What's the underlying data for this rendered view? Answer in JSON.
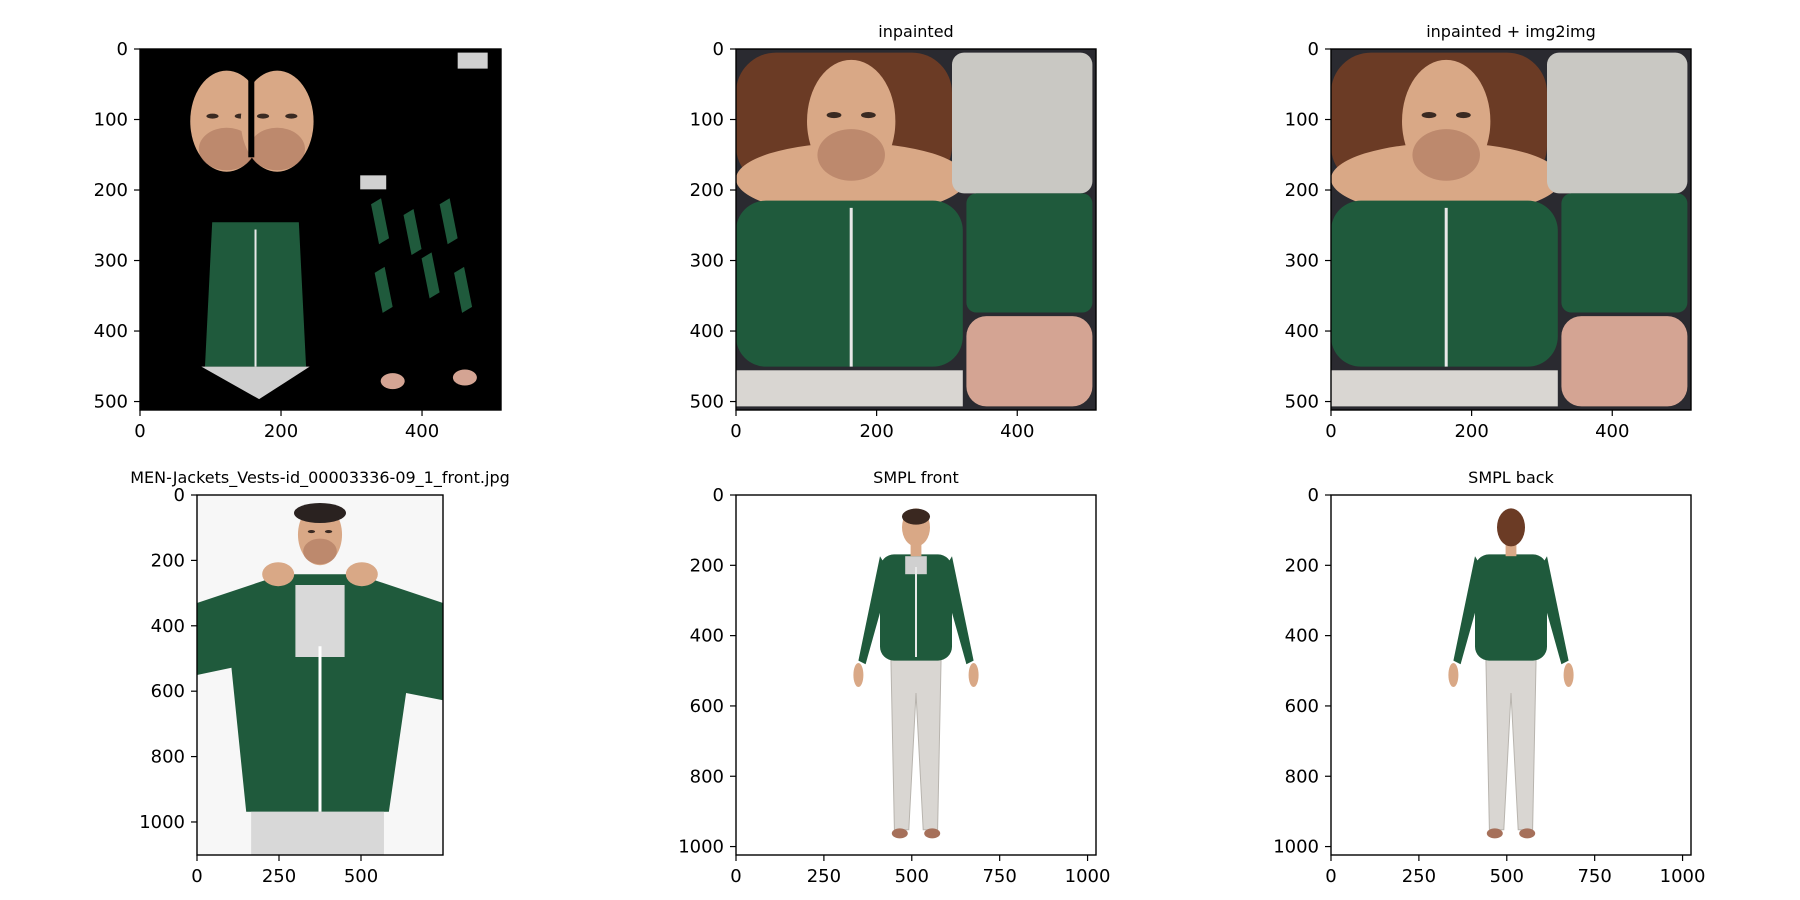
{
  "chart_data": [
    {
      "type": "image",
      "title": "",
      "content": "uv texture (partial)",
      "xlim": [
        0,
        512
      ],
      "ylim": [
        512,
        0
      ],
      "xticks": [
        0,
        200,
        400
      ],
      "yticks": [
        0,
        100,
        200,
        300,
        400,
        500
      ]
    },
    {
      "type": "image",
      "title": "inpainted",
      "content": "uv texture inpainted",
      "xlim": [
        0,
        512
      ],
      "ylim": [
        512,
        0
      ],
      "xticks": [
        0,
        200,
        400
      ],
      "yticks": [
        0,
        100,
        200,
        300,
        400,
        500
      ]
    },
    {
      "type": "image",
      "title": "inpainted + img2img",
      "content": "uv texture inpainted refined",
      "xlim": [
        0,
        512
      ],
      "ylim": [
        512,
        0
      ],
      "xticks": [
        0,
        200,
        400
      ],
      "yticks": [
        0,
        100,
        200,
        300,
        400,
        500
      ]
    },
    {
      "type": "image",
      "title": "MEN-Jackets_Vests-id_00003336-09_1_front.jpg",
      "content": "photo",
      "xlim": [
        0,
        750
      ],
      "ylim": [
        1101,
        0
      ],
      "xticks": [
        0,
        250,
        500
      ],
      "yticks": [
        0,
        200,
        400,
        600,
        800,
        1000
      ]
    },
    {
      "type": "image",
      "title": "SMPL front",
      "content": "render front",
      "xlim": [
        0,
        1024
      ],
      "ylim": [
        1024,
        0
      ],
      "xticks": [
        0,
        250,
        500,
        750,
        1000
      ],
      "yticks": [
        0,
        200,
        400,
        600,
        800,
        1000
      ]
    },
    {
      "type": "image",
      "title": "SMPL back",
      "content": "render back",
      "xlim": [
        0,
        1024
      ],
      "ylim": [
        1024,
        0
      ],
      "xticks": [
        0,
        250,
        500,
        750,
        1000
      ],
      "yticks": [
        0,
        200,
        400,
        600,
        800,
        1000
      ]
    }
  ],
  "colors": {
    "jacket": "#1f5a3c",
    "jacket_dark": "#163f2b",
    "skin": "#d9a886",
    "skin_dark": "#a6705a",
    "hair": "#6b3b25",
    "pants": "#d9d6d2",
    "bg_dark": "#2a2a30",
    "black": "#000000"
  }
}
